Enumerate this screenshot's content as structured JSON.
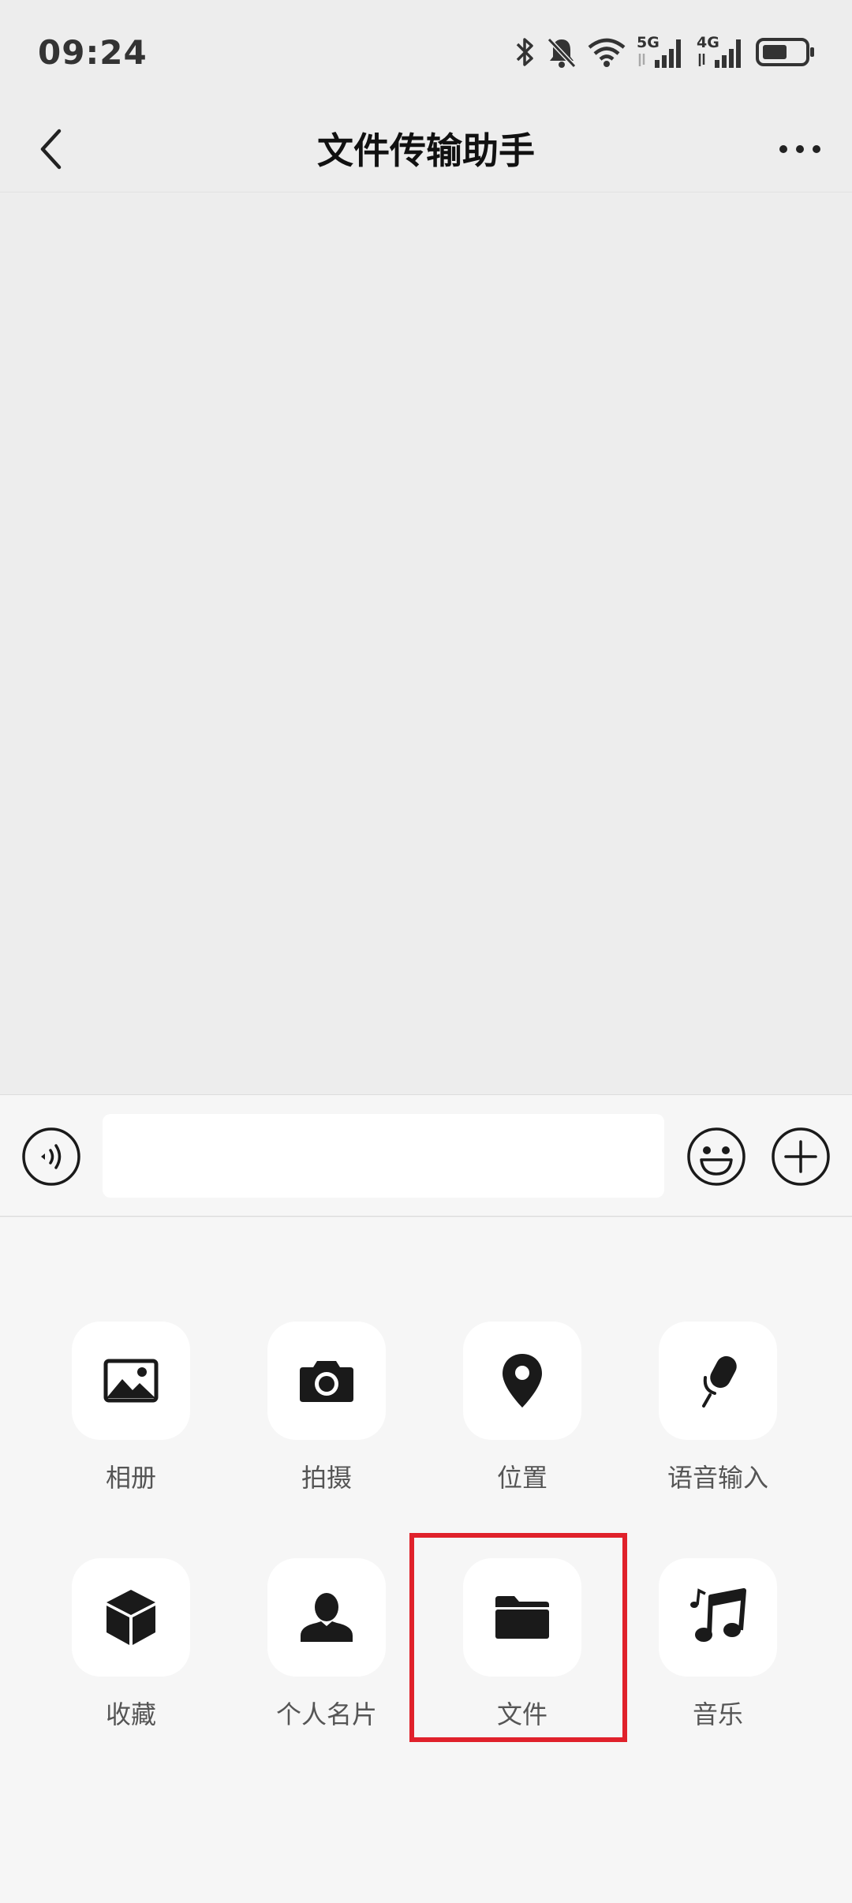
{
  "status_bar": {
    "time": "09:24",
    "network_5g": "5G",
    "network_4g": "4G",
    "icons": [
      "bluetooth-icon",
      "mute-bell-icon",
      "wifi-icon",
      "signal-5g-icon",
      "signal-4g-icon",
      "battery-icon"
    ]
  },
  "header": {
    "title": "文件传输助手",
    "back_icon": "chevron-left-icon",
    "more_icon": "more-dots-icon"
  },
  "input_bar": {
    "message_value": "",
    "message_placeholder": "",
    "voice_icon": "voice-icon",
    "emoji_icon": "emoji-icon",
    "plus_icon": "plus-circle-icon"
  },
  "panel": {
    "tools": [
      {
        "label": "相册",
        "icon": "image-icon"
      },
      {
        "label": "拍摄",
        "icon": "camera-icon"
      },
      {
        "label": "位置",
        "icon": "location-pin-icon"
      },
      {
        "label": "语音输入",
        "icon": "microphone-icon"
      },
      {
        "label": "收藏",
        "icon": "cube-icon"
      },
      {
        "label": "个人名片",
        "icon": "person-icon"
      },
      {
        "label": "文件",
        "icon": "folder-icon"
      },
      {
        "label": "音乐",
        "icon": "music-note-icon"
      }
    ]
  },
  "colors": {
    "background": "#ededed",
    "panel": "#f6f6f6",
    "tile": "#ffffff",
    "highlight": "#e0212b"
  }
}
